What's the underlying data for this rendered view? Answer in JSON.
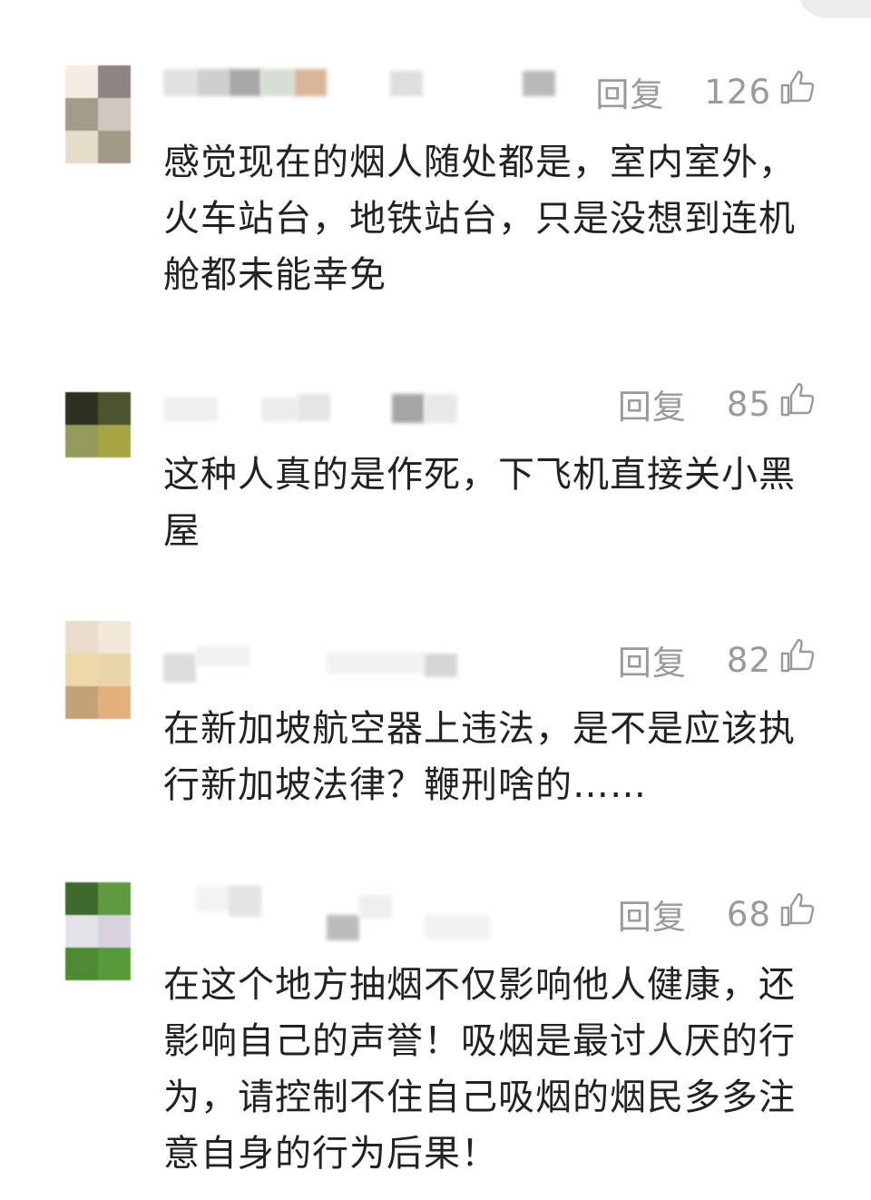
{
  "comments": [
    {
      "reply_label": "回复",
      "likes": "126",
      "text": "感觉现在的烟人随处都是，室内室外，\n火车站台，地铁站台，只是没想到连机\n舱都未能幸免"
    },
    {
      "reply_label": "回复",
      "likes": "85",
      "text": "这种人真的是作死，下飞机直接关小黑\n屋"
    },
    {
      "reply_label": "回复",
      "likes": "82",
      "text": "在新加坡航空器上违法，是不是应该执\n行新加坡法律？鞭刑啥的……"
    },
    {
      "reply_label": "回复",
      "likes": "68",
      "text": "在这个地方抽烟不仅影响他人健康，还\n影响自己的声誉！吸烟是最讨人厌的行\n为，请控制不住自己吸烟的烟民多多注\n意自身的行为后果！"
    }
  ],
  "icons": {
    "like": "thumbs-up-icon"
  },
  "colors": {
    "action_gray": "#9a9a9a",
    "text": "#222222"
  }
}
